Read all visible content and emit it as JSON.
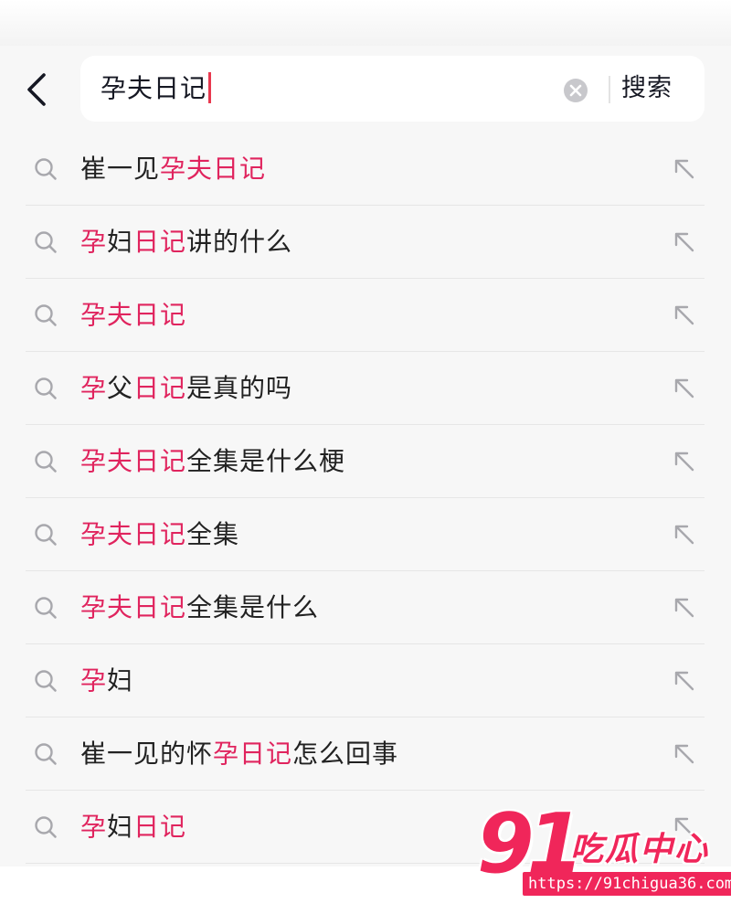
{
  "search": {
    "query": "孕夫日记",
    "button_label": "搜索"
  },
  "icons": {
    "back": "chevron-left-icon",
    "clear": "clear-circle-icon",
    "suggestion": "search-icon",
    "fill": "arrow-up-left-icon"
  },
  "colors": {
    "highlight": "#e0245e",
    "caret": "#e8394f",
    "text": "#222222",
    "watermark": "#f0265a"
  },
  "suggestions": [
    {
      "text": "崔一见孕夫日记",
      "segments": [
        {
          "t": "崔一见",
          "h": false
        },
        {
          "t": "孕夫日记",
          "h": true
        }
      ]
    },
    {
      "text": "孕妇日记讲的什么",
      "segments": [
        {
          "t": "孕",
          "h": true
        },
        {
          "t": "妇",
          "h": false
        },
        {
          "t": "日记",
          "h": true
        },
        {
          "t": "讲的什么",
          "h": false
        }
      ]
    },
    {
      "text": "孕夫日记",
      "segments": [
        {
          "t": "孕夫日记",
          "h": true
        }
      ]
    },
    {
      "text": "孕父日记是真的吗",
      "segments": [
        {
          "t": "孕",
          "h": true
        },
        {
          "t": "父",
          "h": false
        },
        {
          "t": "日记",
          "h": true
        },
        {
          "t": "是真的吗",
          "h": false
        }
      ]
    },
    {
      "text": "孕夫日记全集是什么梗",
      "segments": [
        {
          "t": "孕夫日记",
          "h": true
        },
        {
          "t": "全集是什么梗",
          "h": false
        }
      ]
    },
    {
      "text": "孕夫日记全集",
      "segments": [
        {
          "t": "孕夫日记",
          "h": true
        },
        {
          "t": "全集",
          "h": false
        }
      ]
    },
    {
      "text": "孕夫日记全集是什么",
      "segments": [
        {
          "t": "孕夫日记",
          "h": true
        },
        {
          "t": "全集是什么",
          "h": false
        }
      ]
    },
    {
      "text": "孕妇",
      "segments": [
        {
          "t": "孕",
          "h": true
        },
        {
          "t": "妇",
          "h": false
        }
      ]
    },
    {
      "text": "崔一见的怀孕日记怎么回事",
      "segments": [
        {
          "t": "崔一见的怀",
          "h": false
        },
        {
          "t": "孕日记",
          "h": true
        },
        {
          "t": "怎么回事",
          "h": false
        }
      ]
    },
    {
      "text": "孕妇日记",
      "segments": [
        {
          "t": "孕",
          "h": true
        },
        {
          "t": "妇",
          "h": false
        },
        {
          "t": "日记",
          "h": true
        }
      ]
    }
  ],
  "watermark": {
    "number": "91",
    "name": "吃瓜中心",
    "url": "https://91chigua36.com"
  }
}
